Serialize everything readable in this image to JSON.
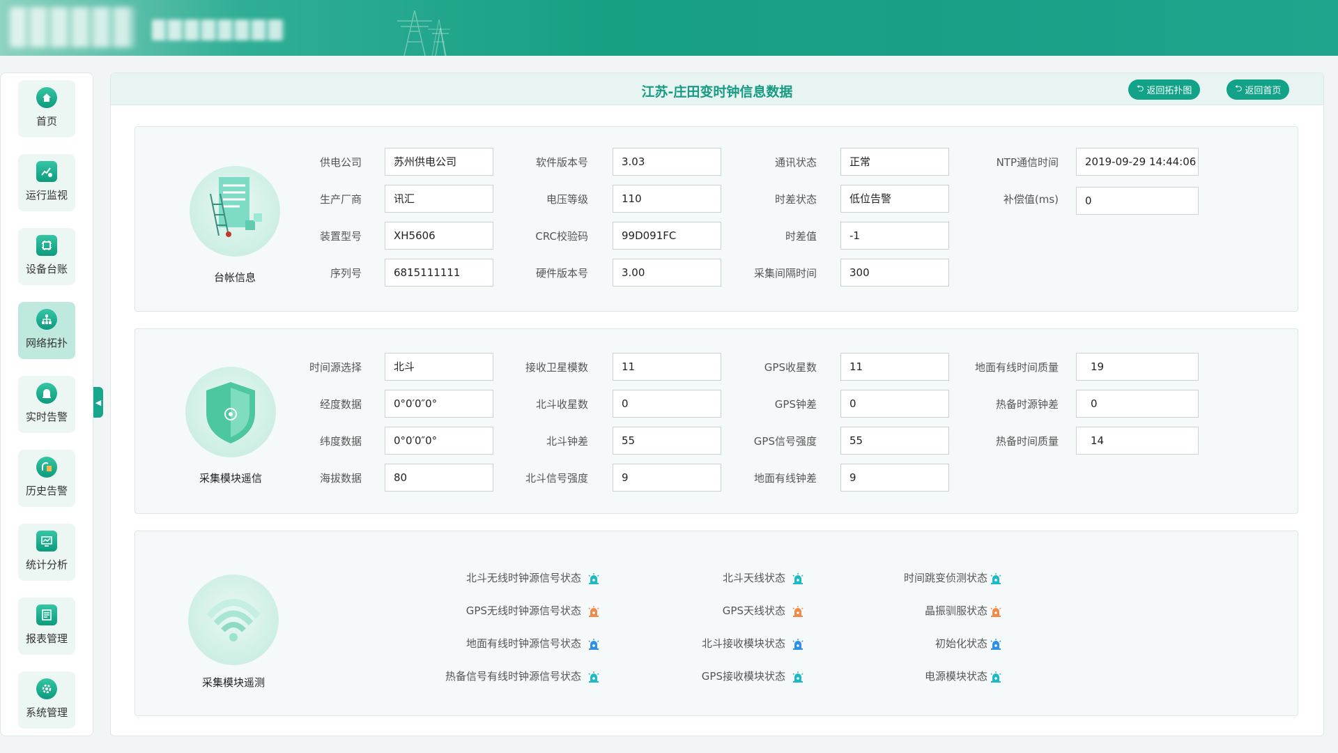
{
  "page": {
    "title": "江苏-庄田变时钟信息数据",
    "back_topology": "返回拓扑图",
    "back_home": "返回首页"
  },
  "colors": {
    "accent": "#12a287",
    "status_ok": "#1fb8c7",
    "status_warn": "#f08a4b",
    "status_blue": "#2f8fe6"
  },
  "sidebar": {
    "items": [
      {
        "label": "首页",
        "icon": "home-icon"
      },
      {
        "label": "运行监视",
        "icon": "monitor-chart-icon"
      },
      {
        "label": "设备台账",
        "icon": "chip-icon"
      },
      {
        "label": "网络拓扑",
        "icon": "network-icon",
        "active": true
      },
      {
        "label": "实时告警",
        "icon": "realtime-alarm-icon"
      },
      {
        "label": "历史告警",
        "icon": "history-alarm-icon"
      },
      {
        "label": "统计分析",
        "icon": "statistics-icon"
      },
      {
        "label": "报表管理",
        "icon": "report-icon"
      },
      {
        "label": "系统管理",
        "icon": "system-gear-icon"
      }
    ]
  },
  "ledger": {
    "name": "台帐信息",
    "fields": [
      {
        "label": "供电公司",
        "value": "苏州供电公司"
      },
      {
        "label": "生产厂商",
        "value": "讯汇"
      },
      {
        "label": "装置型号",
        "value": "XH5606"
      },
      {
        "label": "序列号",
        "value": "6815111111"
      },
      {
        "label": "软件版本号",
        "value": "3.03"
      },
      {
        "label": "电压等级",
        "value": "110"
      },
      {
        "label": "CRC校验码",
        "value": "99D091FC"
      },
      {
        "label": "硬件版本号",
        "value": "3.00"
      },
      {
        "label": "通讯状态",
        "value": "正常"
      },
      {
        "label": "时差状态",
        "value": "低位告警"
      },
      {
        "label": "时差值",
        "value": "-1"
      },
      {
        "label": "采集间隔时间",
        "value": "300"
      },
      {
        "label": "NTP通信时间",
        "value": "2019-09-29 14:44:06"
      },
      {
        "label": "补偿值(ms)",
        "value": "0"
      }
    ]
  },
  "comm": {
    "name": "采集模块遥信",
    "fields": [
      {
        "label": "时间源选择",
        "value": "北斗"
      },
      {
        "label": "经度数据",
        "value": "0°0′0″0°"
      },
      {
        "label": "纬度数据",
        "value": "0°0′0″0°"
      },
      {
        "label": "海拔数据",
        "value": "80"
      },
      {
        "label": "接收卫星模数",
        "value": "11"
      },
      {
        "label": "北斗收星数",
        "value": "0"
      },
      {
        "label": "北斗钟差",
        "value": "55"
      },
      {
        "label": "北斗信号强度",
        "value": "9"
      },
      {
        "label": "GPS收星数",
        "value": "11"
      },
      {
        "label": "GPS钟差",
        "value": "0"
      },
      {
        "label": "GPS信号强度",
        "value": "55"
      },
      {
        "label": "地面有线钟差",
        "value": "9"
      },
      {
        "label": "地面有线时间质量",
        "value": "19"
      },
      {
        "label": "热备时源钟差",
        "value": "0"
      },
      {
        "label": "热备时间质量",
        "value": "14"
      }
    ]
  },
  "telemetry": {
    "name": "采集模块遥测",
    "items": [
      {
        "label": "北斗无线时钟源信号状态",
        "status": "ok"
      },
      {
        "label": "GPS无线时钟源信号状态",
        "status": "warn"
      },
      {
        "label": "地面有线时钟源信号状态",
        "status": "blue"
      },
      {
        "label": "热备信号有线时钟源信号状态",
        "status": "ok"
      },
      {
        "label": "北斗天线状态",
        "status": "ok"
      },
      {
        "label": "GPS天线状态",
        "status": "warn"
      },
      {
        "label": "北斗接收模块状态",
        "status": "blue"
      },
      {
        "label": "GPS接收模块状态",
        "status": "ok"
      },
      {
        "label": "时间跳变侦测状态",
        "status": "ok"
      },
      {
        "label": "晶振驯服状态",
        "status": "warn"
      },
      {
        "label": "初始化状态",
        "status": "blue"
      },
      {
        "label": "电源模块状态",
        "status": "ok"
      }
    ]
  }
}
